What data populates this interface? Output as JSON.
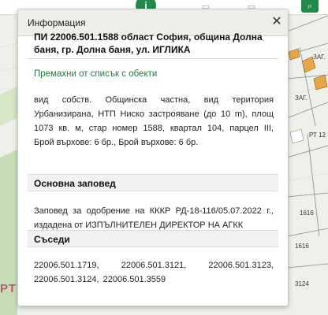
{
  "panel": {
    "title": "Информация",
    "close_symbol": "✕",
    "parcel_title": "ПИ 22006.501.1588 област София, община Долна баня, гр. Долна баня, ул. ИГЛИКА",
    "remove_link": "Премахни от списък с обекти",
    "description_lines": [
      "вид собств. Общинска частна, вид територия",
      "Урбанизирана, НТП Ниско застрояване (до 10 m), площ",
      "1073 кв. м, стар номер 1588, квартал 104, парцел III,",
      "Брой върхове: 6 бр., Брой върхове: 6 бр."
    ],
    "order_section": {
      "heading": "Основна заповед",
      "lines": [
        "Заповед за одобрение на КККР РД-18-116/05.07.2022 г.,",
        "издадена от ИЗПЪЛНИТЕЛЕН ДИРЕКТОР НА АГКК"
      ]
    },
    "neighbors_section": {
      "heading": "Съседи",
      "row1": [
        "22006.501.1719,",
        "22006.501.3121,",
        "22006.501.3123,"
      ],
      "row2": [
        "22006.501.3124,",
        "22006.501.3559"
      ]
    }
  },
  "map": {
    "labels": [
      "ЗАГ.",
      "ЗАГ.",
      "РТ 12",
      "1616",
      "1616",
      "3124"
    ],
    "red_label": "РТИСТА"
  },
  "colors": {
    "accent": "#1f8a4c",
    "link": "#1f7a3e",
    "building": "#e8a64b",
    "map_green": "#c6ddb8"
  }
}
